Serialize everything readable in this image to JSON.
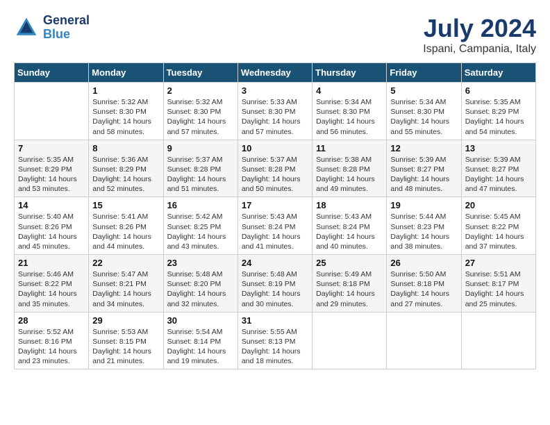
{
  "logo": {
    "line1": "General",
    "line2": "Blue"
  },
  "title": "July 2024",
  "location": "Ispani, Campania, Italy",
  "days_of_week": [
    "Sunday",
    "Monday",
    "Tuesday",
    "Wednesday",
    "Thursday",
    "Friday",
    "Saturday"
  ],
  "weeks": [
    [
      {
        "day": "",
        "info": ""
      },
      {
        "day": "1",
        "info": "Sunrise: 5:32 AM\nSunset: 8:30 PM\nDaylight: 14 hours\nand 58 minutes."
      },
      {
        "day": "2",
        "info": "Sunrise: 5:32 AM\nSunset: 8:30 PM\nDaylight: 14 hours\nand 57 minutes."
      },
      {
        "day": "3",
        "info": "Sunrise: 5:33 AM\nSunset: 8:30 PM\nDaylight: 14 hours\nand 57 minutes."
      },
      {
        "day": "4",
        "info": "Sunrise: 5:34 AM\nSunset: 8:30 PM\nDaylight: 14 hours\nand 56 minutes."
      },
      {
        "day": "5",
        "info": "Sunrise: 5:34 AM\nSunset: 8:30 PM\nDaylight: 14 hours\nand 55 minutes."
      },
      {
        "day": "6",
        "info": "Sunrise: 5:35 AM\nSunset: 8:29 PM\nDaylight: 14 hours\nand 54 minutes."
      }
    ],
    [
      {
        "day": "7",
        "info": "Sunrise: 5:35 AM\nSunset: 8:29 PM\nDaylight: 14 hours\nand 53 minutes."
      },
      {
        "day": "8",
        "info": "Sunrise: 5:36 AM\nSunset: 8:29 PM\nDaylight: 14 hours\nand 52 minutes."
      },
      {
        "day": "9",
        "info": "Sunrise: 5:37 AM\nSunset: 8:28 PM\nDaylight: 14 hours\nand 51 minutes."
      },
      {
        "day": "10",
        "info": "Sunrise: 5:37 AM\nSunset: 8:28 PM\nDaylight: 14 hours\nand 50 minutes."
      },
      {
        "day": "11",
        "info": "Sunrise: 5:38 AM\nSunset: 8:28 PM\nDaylight: 14 hours\nand 49 minutes."
      },
      {
        "day": "12",
        "info": "Sunrise: 5:39 AM\nSunset: 8:27 PM\nDaylight: 14 hours\nand 48 minutes."
      },
      {
        "day": "13",
        "info": "Sunrise: 5:39 AM\nSunset: 8:27 PM\nDaylight: 14 hours\nand 47 minutes."
      }
    ],
    [
      {
        "day": "14",
        "info": "Sunrise: 5:40 AM\nSunset: 8:26 PM\nDaylight: 14 hours\nand 45 minutes."
      },
      {
        "day": "15",
        "info": "Sunrise: 5:41 AM\nSunset: 8:26 PM\nDaylight: 14 hours\nand 44 minutes."
      },
      {
        "day": "16",
        "info": "Sunrise: 5:42 AM\nSunset: 8:25 PM\nDaylight: 14 hours\nand 43 minutes."
      },
      {
        "day": "17",
        "info": "Sunrise: 5:43 AM\nSunset: 8:24 PM\nDaylight: 14 hours\nand 41 minutes."
      },
      {
        "day": "18",
        "info": "Sunrise: 5:43 AM\nSunset: 8:24 PM\nDaylight: 14 hours\nand 40 minutes."
      },
      {
        "day": "19",
        "info": "Sunrise: 5:44 AM\nSunset: 8:23 PM\nDaylight: 14 hours\nand 38 minutes."
      },
      {
        "day": "20",
        "info": "Sunrise: 5:45 AM\nSunset: 8:22 PM\nDaylight: 14 hours\nand 37 minutes."
      }
    ],
    [
      {
        "day": "21",
        "info": "Sunrise: 5:46 AM\nSunset: 8:22 PM\nDaylight: 14 hours\nand 35 minutes."
      },
      {
        "day": "22",
        "info": "Sunrise: 5:47 AM\nSunset: 8:21 PM\nDaylight: 14 hours\nand 34 minutes."
      },
      {
        "day": "23",
        "info": "Sunrise: 5:48 AM\nSunset: 8:20 PM\nDaylight: 14 hours\nand 32 minutes."
      },
      {
        "day": "24",
        "info": "Sunrise: 5:48 AM\nSunset: 8:19 PM\nDaylight: 14 hours\nand 30 minutes."
      },
      {
        "day": "25",
        "info": "Sunrise: 5:49 AM\nSunset: 8:18 PM\nDaylight: 14 hours\nand 29 minutes."
      },
      {
        "day": "26",
        "info": "Sunrise: 5:50 AM\nSunset: 8:18 PM\nDaylight: 14 hours\nand 27 minutes."
      },
      {
        "day": "27",
        "info": "Sunrise: 5:51 AM\nSunset: 8:17 PM\nDaylight: 14 hours\nand 25 minutes."
      }
    ],
    [
      {
        "day": "28",
        "info": "Sunrise: 5:52 AM\nSunset: 8:16 PM\nDaylight: 14 hours\nand 23 minutes."
      },
      {
        "day": "29",
        "info": "Sunrise: 5:53 AM\nSunset: 8:15 PM\nDaylight: 14 hours\nand 21 minutes."
      },
      {
        "day": "30",
        "info": "Sunrise: 5:54 AM\nSunset: 8:14 PM\nDaylight: 14 hours\nand 19 minutes."
      },
      {
        "day": "31",
        "info": "Sunrise: 5:55 AM\nSunset: 8:13 PM\nDaylight: 14 hours\nand 18 minutes."
      },
      {
        "day": "",
        "info": ""
      },
      {
        "day": "",
        "info": ""
      },
      {
        "day": "",
        "info": ""
      }
    ]
  ]
}
